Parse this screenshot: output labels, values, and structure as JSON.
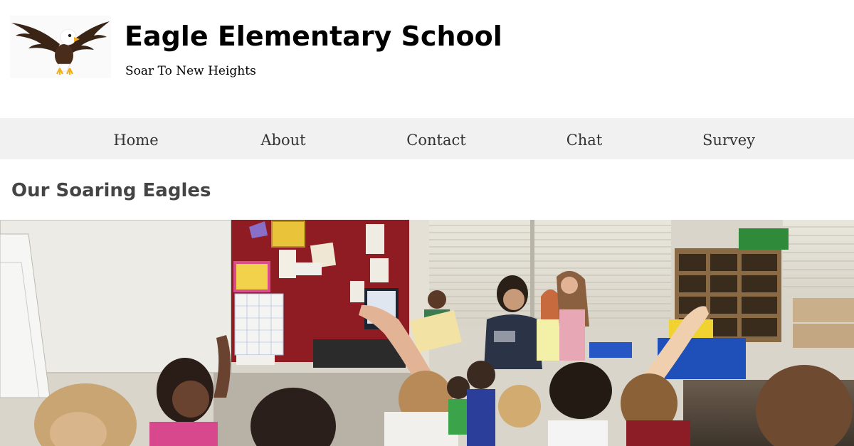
{
  "header": {
    "title": "Eagle Elementary School",
    "tagline": "Soar To New Heights",
    "logo_icon": "eagle-mascot-icon"
  },
  "nav": {
    "items": [
      {
        "label": "Home"
      },
      {
        "label": "About"
      },
      {
        "label": "Contact"
      },
      {
        "label": "Chat"
      },
      {
        "label": "Survey"
      }
    ]
  },
  "main": {
    "section_title": "Our Soaring Eagles",
    "hero_image": "classroom-photo"
  },
  "colors": {
    "nav_background": "#f1f1f1",
    "nav_text": "#333333",
    "section_title": "#444444",
    "classroom_wall_red": "#8e1c22"
  }
}
